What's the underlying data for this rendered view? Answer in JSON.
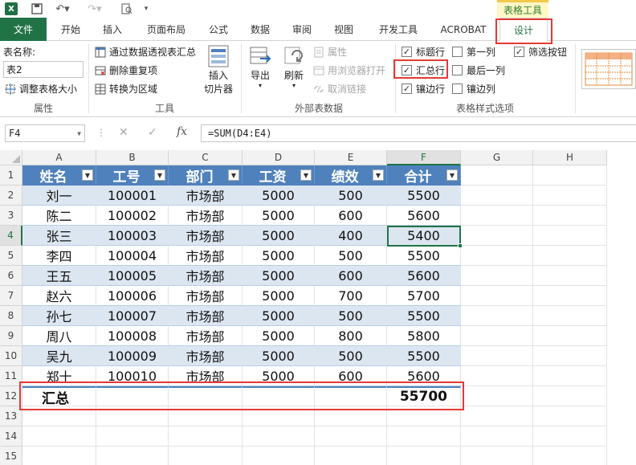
{
  "title_bar": {
    "context_tab_group": "表格工具"
  },
  "tabs": [
    "文件",
    "开始",
    "插入",
    "页面布局",
    "公式",
    "数据",
    "审阅",
    "视图",
    "开发工具",
    "ACROBAT",
    "设计"
  ],
  "ribbon": {
    "properties": {
      "table_name_label": "表名称:",
      "table_name_value": "表2",
      "resize_label": "调整表格大小",
      "group_label": "属性"
    },
    "tools": {
      "pivot_label": "通过数据透视表汇总",
      "remove_dup_label": "删除重复项",
      "convert_label": "转换为区域",
      "slicer_label_line1": "插入",
      "slicer_label_line2": "切片器",
      "group_label": "工具"
    },
    "external": {
      "export_label": "导出",
      "refresh_label": "刷新",
      "properties_label": "属性",
      "browser_label": "用浏览器打开",
      "unlink_label": "取消链接",
      "group_label": "外部表数据"
    },
    "style_options": {
      "header_row": {
        "label": "标题行",
        "checked": true
      },
      "total_row": {
        "label": "汇总行",
        "checked": true
      },
      "banded_rows": {
        "label": "镶边行",
        "checked": true
      },
      "first_column": {
        "label": "第一列",
        "checked": false
      },
      "last_column": {
        "label": "最后一列",
        "checked": false
      },
      "banded_columns": {
        "label": "镶边列",
        "checked": false
      },
      "filter_button": {
        "label": "筛选按钮",
        "checked": true
      },
      "group_label": "表格样式选项"
    }
  },
  "formula_bar": {
    "name_box": "F4",
    "fx_label": "fx",
    "formula": "=SUM(D4:E4)"
  },
  "sheet": {
    "columns": [
      "A",
      "B",
      "C",
      "D",
      "E",
      "F",
      "G",
      "H"
    ],
    "rows": [
      "1",
      "2",
      "3",
      "4",
      "5",
      "6",
      "7",
      "8",
      "9",
      "10",
      "11",
      "12",
      "13",
      "14",
      "15"
    ],
    "table_headers": [
      "姓名",
      "工号",
      "部门",
      "工资",
      "绩效",
      "合计"
    ],
    "table_rows": [
      [
        "刘一",
        "100001",
        "市场部",
        "5000",
        "500",
        "5500"
      ],
      [
        "陈二",
        "100002",
        "市场部",
        "5000",
        "600",
        "5600"
      ],
      [
        "张三",
        "100003",
        "市场部",
        "5000",
        "400",
        "5400"
      ],
      [
        "李四",
        "100004",
        "市场部",
        "5000",
        "500",
        "5500"
      ],
      [
        "王五",
        "100005",
        "市场部",
        "5000",
        "600",
        "5600"
      ],
      [
        "赵六",
        "100006",
        "市场部",
        "5000",
        "700",
        "5700"
      ],
      [
        "孙七",
        "100007",
        "市场部",
        "5000",
        "500",
        "5500"
      ],
      [
        "周八",
        "100008",
        "市场部",
        "5000",
        "800",
        "5800"
      ],
      [
        "吴九",
        "100009",
        "市场部",
        "5000",
        "500",
        "5500"
      ],
      [
        "郑十",
        "100010",
        "市场部",
        "5000",
        "600",
        "5600"
      ]
    ],
    "total_row": {
      "label": "汇总",
      "value": "55700"
    },
    "active_cell": "F4"
  },
  "colors": {
    "excel_green": "#217346",
    "table_header_blue": "#4f81bd",
    "band_blue": "#dce6f1",
    "highlight_red": "#e53935"
  }
}
